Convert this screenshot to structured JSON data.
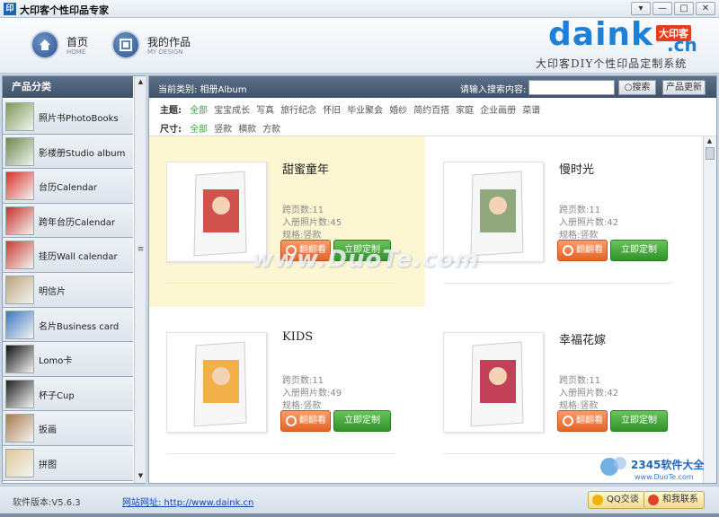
{
  "window": {
    "title": "大印客个性印品专家",
    "icon_glyph": "印",
    "controls": [
      "▾",
      "—",
      "□",
      "✕"
    ]
  },
  "header": {
    "nav": [
      {
        "title": "首页",
        "sub": "HOME",
        "icon": "home-icon"
      },
      {
        "title": "我的作品",
        "sub": "MY DESIGN",
        "icon": "my-design-icon"
      }
    ],
    "logo": {
      "word": "daink",
      "badge": "大印客",
      "cn": ".cn"
    },
    "tagline": "大印客DIY个性印品定制系统"
  },
  "sidebar": {
    "title": "产品分类",
    "items": [
      {
        "label": "照片书PhotoBooks",
        "thumb_color": "#7a9a55"
      },
      {
        "label": "影楼册Studio album",
        "thumb_color": "#6b8a4a"
      },
      {
        "label": "台历Calendar",
        "thumb_color": "#d8322a"
      },
      {
        "label": "跨年台历Calendar",
        "thumb_color": "#c8302a"
      },
      {
        "label": "挂历Wall calendar",
        "thumb_color": "#cc3a30"
      },
      {
        "label": "明信片",
        "thumb_color": "#b9a57a"
      },
      {
        "label": "名片Business card",
        "thumb_color": "#3b78c0"
      },
      {
        "label": "Lomo卡",
        "thumb_color": "#111111"
      },
      {
        "label": "杯子Cup",
        "thumb_color": "#222222"
      },
      {
        "label": "扳画",
        "thumb_color": "#a97a4c"
      },
      {
        "label": "拼图",
        "thumb_color": "#e0c79a"
      }
    ]
  },
  "main": {
    "crumb": "当前类别: 相册Album",
    "search_label": "请输入搜索内容:",
    "search_value": "",
    "search_button": "搜索",
    "update_button": "产品更新",
    "theme_label": "主题:",
    "themes": [
      "全部",
      "宝宝成长",
      "写真",
      "旅行纪念",
      "怀旧",
      "毕业聚会",
      "婚纱",
      "简约百搭",
      "家庭",
      "企业画册",
      "菜谱"
    ],
    "size_label": "尺寸:",
    "sizes": [
      "全部",
      "竖款",
      "横款",
      "方款"
    ]
  },
  "products": [
    {
      "title": "甜蜜童年",
      "pages": "跨页数:11",
      "photos": "入册照片数:45",
      "spec": "规格:竖款",
      "flip": "翻翻看",
      "order": "立即定制",
      "cover_color": "#c8362e"
    },
    {
      "title": "慢时光",
      "pages": "跨页数:11",
      "photos": "入册照片数:42",
      "spec": "规格:竖款",
      "flip": "翻翻看",
      "order": "立即定制",
      "cover_color": "#7f9a6a"
    },
    {
      "title": "KIDS",
      "pages": "跨页数:11",
      "photos": "入册照片数:49",
      "spec": "规格:竖款",
      "flip": "翻翻看",
      "order": "立即定制",
      "cover_color": "#f2a22b"
    },
    {
      "title": "幸福花嫁",
      "pages": "跨页数:11",
      "photos": "入册照片数:42",
      "spec": "规格:竖款",
      "flip": "翻翻看",
      "order": "立即定制",
      "cover_color": "#b8203c"
    }
  ],
  "watermark": "www.DuoTe.com",
  "status": {
    "version": "软件版本:V5.6.3",
    "site": "网站网址: http://www.daink.cn",
    "qq": "QQ交谈",
    "contact": "和我联系"
  },
  "corner_logo": {
    "brand": "2345软件大全",
    "url": "www.DuoTe.com"
  }
}
